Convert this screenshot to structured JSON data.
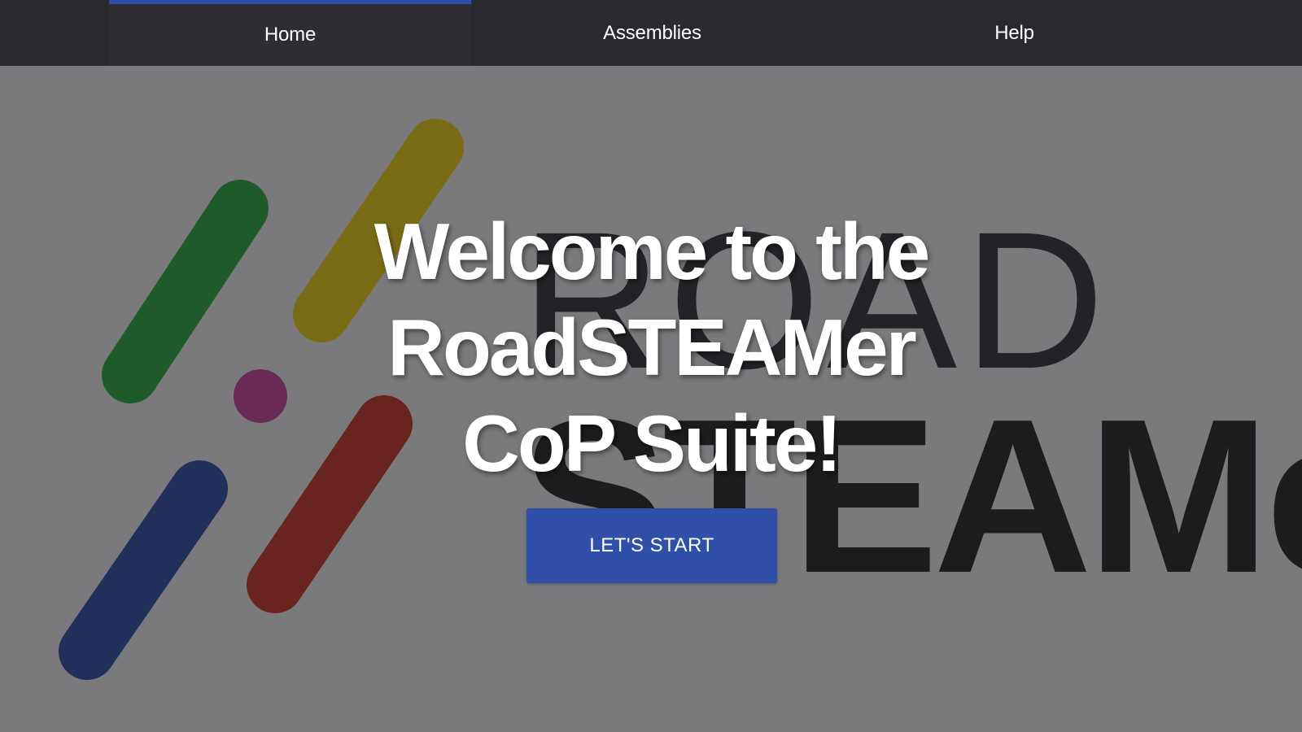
{
  "nav": {
    "tabs": [
      {
        "label": "Home",
        "active": true
      },
      {
        "label": "Assemblies",
        "active": false
      },
      {
        "label": "Help",
        "active": false
      }
    ],
    "active_indicator_color": "#2f4fa8"
  },
  "hero": {
    "logo": {
      "word_top": "ROAD",
      "word_bottom": "STEAMer",
      "stroke_colors": [
        "#1f5a2a",
        "#7a6c16",
        "#6a2a55",
        "#21305a",
        "#6a241f"
      ]
    },
    "headline_line1": "Welcome to the RoadSTEAMer",
    "headline_line2": "CoP Suite!",
    "cta_label": "LET'S START",
    "cta_color": "#2f4fa8"
  }
}
